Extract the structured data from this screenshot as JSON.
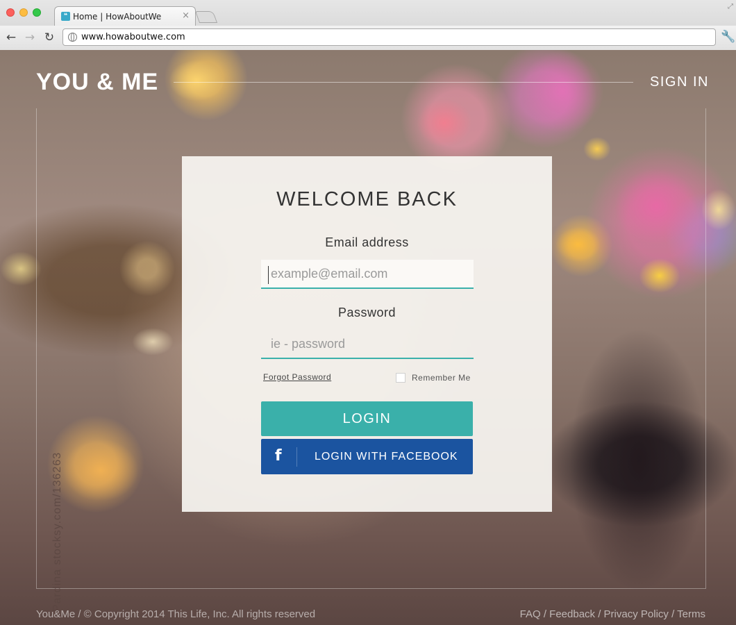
{
  "browser": {
    "tab_title": "Home | HowAboutWe",
    "tab_close": "×",
    "favicon_glyph": "❝",
    "url": "www.howaboutwe.com",
    "back_glyph": "←",
    "forward_glyph": "→",
    "reload_glyph": "↻",
    "wrench_glyph": "🔧",
    "resize_glyph": "⤢"
  },
  "header": {
    "logo": "YOU & ME",
    "signin": "SIGN IN"
  },
  "photo_credit": "Pardina stocksy.com/136263",
  "login": {
    "title": "WELCOME BACK",
    "email_label": "Email address",
    "email_placeholder": "example@email.com",
    "password_label": "Password",
    "password_placeholder": "ie - password",
    "forgot": "Forgot Password",
    "remember": "Remember Me",
    "login_button": "LOGIN",
    "facebook_icon": "f",
    "facebook_button": "LOGIN WITH FACEBOOK"
  },
  "footer": {
    "copyright": "You&Me / © Copyright 2014 This Life, Inc. All rights reserved",
    "links": [
      "FAQ",
      "Feedback",
      "Privacy Policy",
      "Terms"
    ]
  },
  "colors": {
    "accent": "#3ab0aa",
    "facebook": "#1b54a0"
  }
}
